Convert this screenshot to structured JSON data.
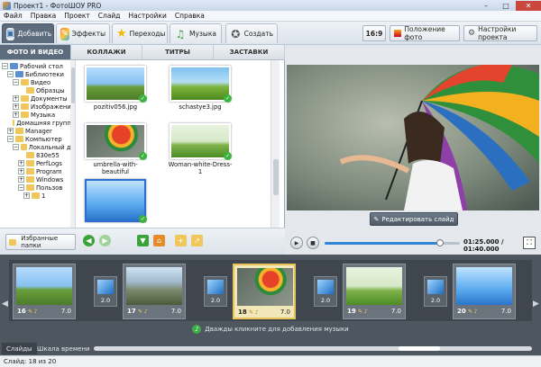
{
  "window": {
    "title": "Проект1 - ФотоШОУ PRO",
    "minimize": "–",
    "maximize": "□",
    "close": "✕"
  },
  "menu": [
    "Файл",
    "Правка",
    "Проект",
    "Слайд",
    "Настройки",
    "Справка"
  ],
  "toolbar": {
    "tabs": [
      {
        "label": "Добавить",
        "icon": "add-photo-icon"
      },
      {
        "label": "Эффекты",
        "icon": "effects-icon"
      },
      {
        "label": "Переходы",
        "icon": "star-transitions-icon"
      },
      {
        "label": "Музыка",
        "icon": "music-icon"
      },
      {
        "label": "Создать",
        "icon": "film-reel-icon"
      }
    ],
    "aspect": "16:9",
    "photo_position": "Положение фото",
    "project_settings": "Настройки проекта"
  },
  "subtabs": [
    "ФОТО И ВИДЕО",
    "КОЛЛАЖИ",
    "ТИТРЫ",
    "ЗАСТАВКИ"
  ],
  "tree": [
    {
      "label": "Рабочий стол",
      "depth": 0,
      "expander": "−"
    },
    {
      "label": "Библиотеки",
      "depth": 1,
      "expander": "−"
    },
    {
      "label": "Видео",
      "depth": 2,
      "expander": "−"
    },
    {
      "label": "Образцы",
      "depth": 3,
      "expander": ""
    },
    {
      "label": "Документы",
      "depth": 2,
      "expander": "+"
    },
    {
      "label": "Изображения",
      "depth": 2,
      "expander": "+"
    },
    {
      "label": "Музыка",
      "depth": 2,
      "expander": "+"
    },
    {
      "label": "Домашняя группа",
      "depth": 1,
      "expander": ""
    },
    {
      "label": "Manager",
      "depth": 1,
      "expander": "+"
    },
    {
      "label": "Компьютер",
      "depth": 1,
      "expander": "−"
    },
    {
      "label": "Локальный ди",
      "depth": 2,
      "expander": "−"
    },
    {
      "label": "830e55",
      "depth": 3,
      "expander": ""
    },
    {
      "label": "PerfLogs",
      "depth": 3,
      "expander": "+"
    },
    {
      "label": "Program",
      "depth": 3,
      "expander": "+"
    },
    {
      "label": "Windows",
      "depth": 3,
      "expander": "+"
    },
    {
      "label": "Пользов",
      "depth": 3,
      "expander": "−"
    },
    {
      "label": "1",
      "depth": 4,
      "expander": "+"
    }
  ],
  "files": [
    {
      "name": "pozitiv056.jpg",
      "checked": true
    },
    {
      "name": "schastye3.jpg",
      "checked": true
    },
    {
      "name": "umbrella-with-beautiful",
      "checked": true
    },
    {
      "name": "Woman-white-Dress-1",
      "checked": true
    },
    {
      "name": "",
      "checked": true
    }
  ],
  "left_bottom": {
    "favorites": "Избранные папки"
  },
  "preview": {
    "edit_slide": "Редактировать слайд",
    "time": "01:25.000 / 01:40.000",
    "progress": 0.85
  },
  "timeline": {
    "slides": [
      {
        "num": "16",
        "dur": "7.0"
      },
      {
        "num": "17",
        "dur": "7.0"
      },
      {
        "num": "18",
        "dur": "7.0",
        "active": true
      },
      {
        "num": "19",
        "dur": "7.0"
      },
      {
        "num": "20",
        "dur": "7.0"
      }
    ],
    "transitions": [
      "2.0",
      "2.0",
      "2.0",
      "2.0"
    ],
    "music_hint": "Дважды кликните для добавления музыки"
  },
  "bottom_tabs": [
    "Слайды",
    "Шкала времени"
  ],
  "status": "Слайд: 18 из 20"
}
